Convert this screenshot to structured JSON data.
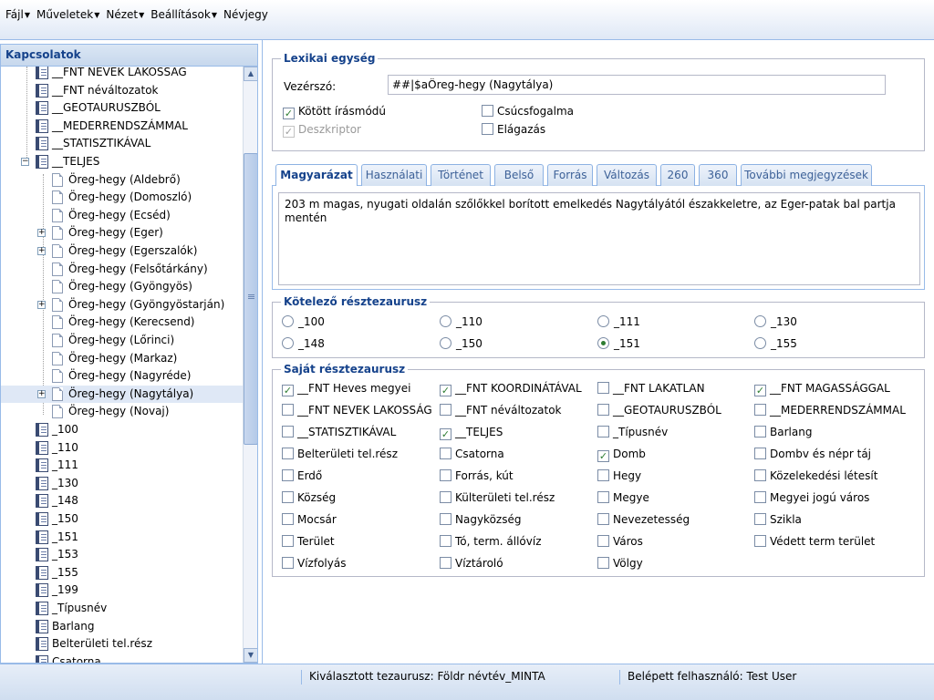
{
  "menu": [
    {
      "label": "Fájl",
      "has_arrow": true
    },
    {
      "label": "Műveletek",
      "has_arrow": true
    },
    {
      "label": "Nézet",
      "has_arrow": true
    },
    {
      "label": "Beállítások",
      "has_arrow": true
    },
    {
      "label": "Névjegy",
      "has_arrow": false
    }
  ],
  "left_panel": {
    "title": "Kapcsolatok",
    "tree": [
      {
        "label": "__FNT NEVEK LAKOSSÁG",
        "level": 1,
        "icon": "book-icon"
      },
      {
        "label": "__FNT néváltozatok",
        "level": 1,
        "icon": "book-icon"
      },
      {
        "label": "__GEOTAURUSZBÓL",
        "level": 1,
        "icon": "book-icon"
      },
      {
        "label": "__MEDERRENDSZÁMMAL",
        "level": 1,
        "icon": "book-icon"
      },
      {
        "label": "__STATISZTIKÁVAL",
        "level": 1,
        "icon": "book-icon"
      },
      {
        "label": "__TELJES",
        "level": 1,
        "icon": "book-icon",
        "expander": "−"
      },
      {
        "label": "Öreg-hegy (Aldebrő)",
        "level": 2,
        "icon": "page-icon"
      },
      {
        "label": "Öreg-hegy (Domoszló)",
        "level": 2,
        "icon": "page-icon"
      },
      {
        "label": "Öreg-hegy (Ecséd)",
        "level": 2,
        "icon": "page-icon"
      },
      {
        "label": "Öreg-hegy (Eger)",
        "level": 2,
        "icon": "page-icon",
        "expander": "+"
      },
      {
        "label": "Öreg-hegy (Egerszalók)",
        "level": 2,
        "icon": "page-icon",
        "expander": "+"
      },
      {
        "label": "Öreg-hegy (Felsőtárkány)",
        "level": 2,
        "icon": "page-icon"
      },
      {
        "label": "Öreg-hegy (Gyöngyös)",
        "level": 2,
        "icon": "page-icon"
      },
      {
        "label": "Öreg-hegy (Gyöngyöstarján)",
        "level": 2,
        "icon": "page-icon",
        "expander": "+"
      },
      {
        "label": "Öreg-hegy (Kerecsend)",
        "level": 2,
        "icon": "page-icon"
      },
      {
        "label": "Öreg-hegy (Lőrinci)",
        "level": 2,
        "icon": "page-icon"
      },
      {
        "label": "Öreg-hegy (Markaz)",
        "level": 2,
        "icon": "page-icon"
      },
      {
        "label": "Öreg-hegy (Nagyréde)",
        "level": 2,
        "icon": "page-icon"
      },
      {
        "label": "Öreg-hegy (Nagytálya)",
        "level": 2,
        "icon": "page-icon",
        "expander": "+",
        "selected": true
      },
      {
        "label": "Öreg-hegy (Novaj)",
        "level": 2,
        "icon": "page-icon"
      },
      {
        "label": "_100",
        "level": 0,
        "icon": "book-icon"
      },
      {
        "label": "_110",
        "level": 0,
        "icon": "book-icon"
      },
      {
        "label": "_111",
        "level": 0,
        "icon": "book-icon"
      },
      {
        "label": "_130",
        "level": 0,
        "icon": "book-icon"
      },
      {
        "label": "_148",
        "level": 0,
        "icon": "book-icon"
      },
      {
        "label": "_150",
        "level": 0,
        "icon": "book-icon"
      },
      {
        "label": "_151",
        "level": 0,
        "icon": "book-icon"
      },
      {
        "label": "_153",
        "level": 0,
        "icon": "book-icon"
      },
      {
        "label": "_155",
        "level": 0,
        "icon": "book-icon"
      },
      {
        "label": "_199",
        "level": 0,
        "icon": "book-icon"
      },
      {
        "label": "_Típusnév",
        "level": 0,
        "icon": "book-icon"
      },
      {
        "label": "Barlang",
        "level": 0,
        "icon": "book-icon"
      },
      {
        "label": "Belterületi tel.rész",
        "level": 0,
        "icon": "book-icon"
      },
      {
        "label": "Csatorna",
        "level": 0,
        "icon": "book-icon"
      }
    ]
  },
  "lexical": {
    "legend": "Lexikai egység",
    "headword_label": "Vezérszó:",
    "headword_value": "##|$aÖreg-hegy (Nagytálya)",
    "checkboxes": [
      {
        "label": "Kötött írásmódú",
        "checked": true,
        "disabled": false
      },
      {
        "label": "Csúcsfogalma",
        "checked": false,
        "disabled": false
      },
      {
        "label": "Deszkriptor",
        "checked": true,
        "disabled": true
      },
      {
        "label": "Elágazás",
        "checked": false,
        "disabled": false
      }
    ]
  },
  "tabs": {
    "items": [
      "Magyarázat",
      "Használati",
      "Történet",
      "Belső",
      "Forrás",
      "Változás",
      "260",
      "360",
      "További megjegyzések"
    ],
    "active_index": 0,
    "content": "203 m magas, nyugati oldalán szőlőkkel borított emelkedés Nagytályától északkeletre, az Eger-patak bal partja mentén"
  },
  "mandatory": {
    "legend": "Kötelező résztezaurusz",
    "options": [
      {
        "label": "_100",
        "selected": false
      },
      {
        "label": "_110",
        "selected": false
      },
      {
        "label": "_111",
        "selected": false
      },
      {
        "label": "_130",
        "selected": false
      },
      {
        "label": "_148",
        "selected": false
      },
      {
        "label": "_150",
        "selected": false
      },
      {
        "label": "_151",
        "selected": true
      },
      {
        "label": "_155",
        "selected": false
      }
    ]
  },
  "own": {
    "legend": "Saját résztezaurusz",
    "options": [
      {
        "label": "__FNT Heves megyei",
        "checked": true
      },
      {
        "label": "__FNT KOORDINÁTÁVAL",
        "checked": true
      },
      {
        "label": "__FNT LAKATLAN",
        "checked": false
      },
      {
        "label": "__FNT MAGASSÁGGAL",
        "checked": true
      },
      {
        "label": "__FNT NEVEK LAKOSSÁG",
        "checked": false
      },
      {
        "label": "__FNT néváltozatok",
        "checked": false
      },
      {
        "label": "__GEOTAURUSZBÓL",
        "checked": false
      },
      {
        "label": "__MEDERRENDSZÁMMAL",
        "checked": false
      },
      {
        "label": "__STATISZTIKÁVAL",
        "checked": false
      },
      {
        "label": "__TELJES",
        "checked": true
      },
      {
        "label": "_Típusnév",
        "checked": false
      },
      {
        "label": "Barlang",
        "checked": false
      },
      {
        "label": "Belterületi tel.rész",
        "checked": false
      },
      {
        "label": "Csatorna",
        "checked": false
      },
      {
        "label": "Domb",
        "checked": true
      },
      {
        "label": "Dombv és népr táj",
        "checked": false
      },
      {
        "label": "Erdő",
        "checked": false
      },
      {
        "label": "Forrás, kút",
        "checked": false
      },
      {
        "label": "Hegy",
        "checked": false
      },
      {
        "label": "Közelekedési létesít",
        "checked": false
      },
      {
        "label": "Község",
        "checked": false
      },
      {
        "label": "Külterületi tel.rész",
        "checked": false
      },
      {
        "label": "Megye",
        "checked": false
      },
      {
        "label": "Megyei jogú város",
        "checked": false
      },
      {
        "label": "Mocsár",
        "checked": false
      },
      {
        "label": "Nagyközség",
        "checked": false
      },
      {
        "label": "Nevezetesség",
        "checked": false
      },
      {
        "label": "Szikla",
        "checked": false
      },
      {
        "label": "Terület",
        "checked": false
      },
      {
        "label": "Tó, term. állóvíz",
        "checked": false
      },
      {
        "label": "Város",
        "checked": false
      },
      {
        "label": "Védett term terület",
        "checked": false
      },
      {
        "label": "Vízfolyás",
        "checked": false
      },
      {
        "label": "Víztároló",
        "checked": false
      },
      {
        "label": "Völgy",
        "checked": false
      }
    ]
  },
  "status": {
    "thesaurus": "Kiválasztott tezaurusz: Földr névtév_MINTA",
    "user": "Belépett felhasználó: Test User"
  },
  "colors": {
    "header_text": "#15428b",
    "border": "#99bbe8",
    "check_mark": "#2e7d32"
  }
}
